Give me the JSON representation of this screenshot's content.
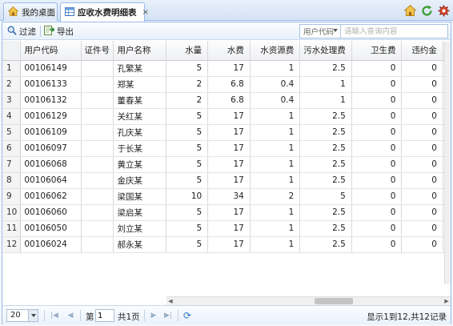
{
  "tabs": [
    {
      "label": "我的桌面",
      "icon": "home-icon",
      "active": false
    },
    {
      "label": "应收水费明细表",
      "icon": "table-icon",
      "active": true,
      "closable": true
    }
  ],
  "tab_close_symbol": "×",
  "toolbar": {
    "filter_label": "过滤",
    "export_label": "导出",
    "search_field": "用户代码",
    "search_placeholder": "请输入查询内容"
  },
  "grid": {
    "columns": [
      "",
      "用户代码",
      "证件号",
      "用户名称",
      "水量",
      "水费",
      "水资源费",
      "污水处理费",
      "卫生费",
      "违约金"
    ],
    "rows": [
      [
        "1",
        "00106149",
        "",
        "孔繁某",
        "5",
        "17",
        "1",
        "2.5",
        "0",
        "0"
      ],
      [
        "2",
        "00106133",
        "",
        "郑某",
        "2",
        "6.8",
        "0.4",
        "1",
        "0",
        "0"
      ],
      [
        "3",
        "00106132",
        "",
        "董春某",
        "2",
        "6.8",
        "0.4",
        "1",
        "0",
        "0"
      ],
      [
        "4",
        "00106129",
        "",
        "关红某",
        "5",
        "17",
        "1",
        "2.5",
        "0",
        "0"
      ],
      [
        "5",
        "00106109",
        "",
        "孔庆某",
        "5",
        "17",
        "1",
        "2.5",
        "0",
        "0"
      ],
      [
        "6",
        "00106097",
        "",
        "于长某",
        "5",
        "17",
        "1",
        "2.5",
        "0",
        "0"
      ],
      [
        "7",
        "00106068",
        "",
        "黄立某",
        "5",
        "17",
        "1",
        "2.5",
        "0",
        "0"
      ],
      [
        "8",
        "00106064",
        "",
        "金庆某",
        "5",
        "17",
        "1",
        "2.5",
        "0",
        "0"
      ],
      [
        "9",
        "00106062",
        "",
        "梁国某",
        "10",
        "34",
        "2",
        "5",
        "0",
        "0"
      ],
      [
        "10",
        "00106060",
        "",
        "梁启某",
        "5",
        "17",
        "1",
        "2.5",
        "0",
        "0"
      ],
      [
        "11",
        "00106050",
        "",
        "刘立某",
        "5",
        "17",
        "1",
        "2.5",
        "0",
        "0"
      ],
      [
        "12",
        "00106024",
        "",
        "郝永某",
        "5",
        "17",
        "1",
        "2.5",
        "0",
        "0"
      ]
    ]
  },
  "pager": {
    "page_size": "20",
    "page_prefix": "第",
    "current_page": "1",
    "total_pages_label": "共1页",
    "info": "显示1到12,共12记录"
  }
}
